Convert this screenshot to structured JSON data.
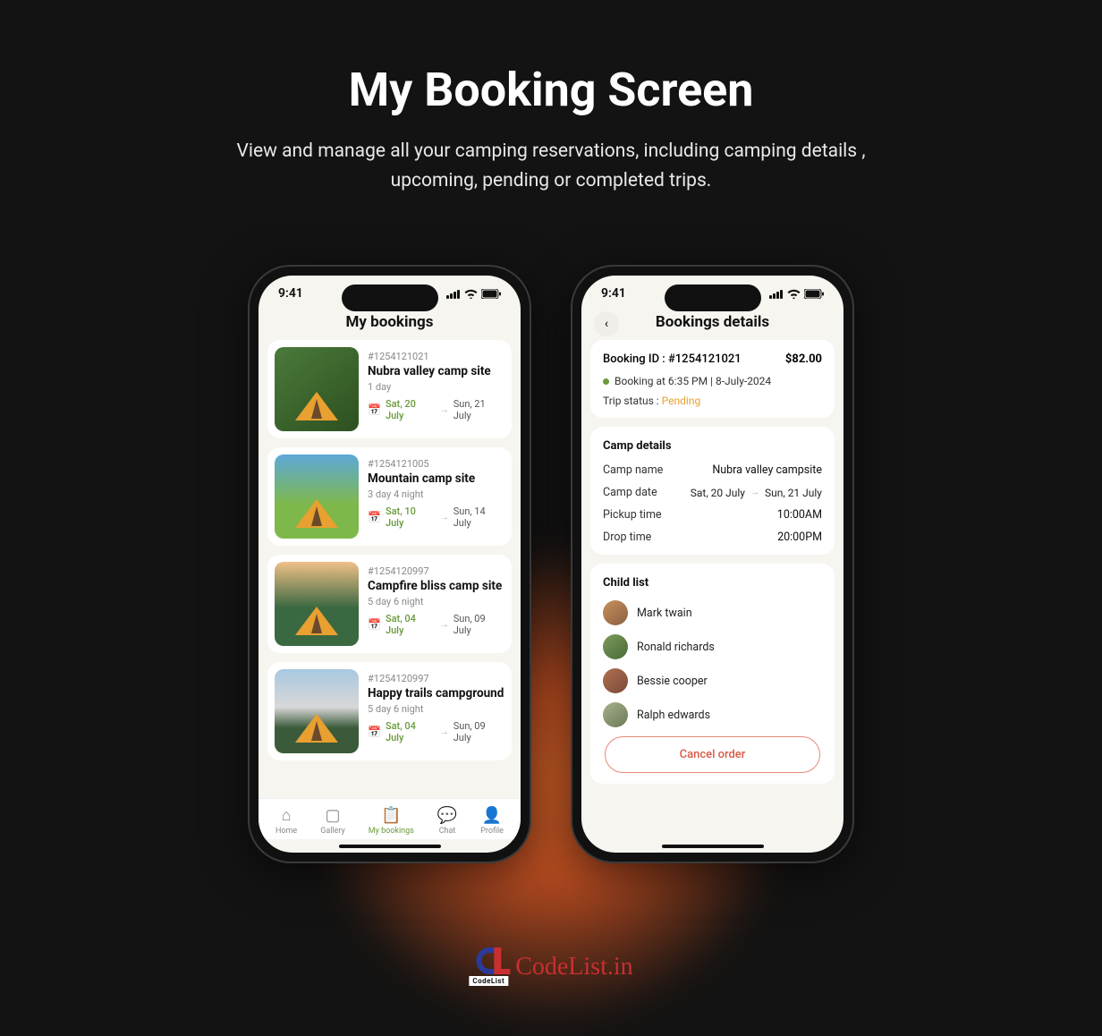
{
  "page": {
    "title": "My Booking Screen",
    "subtitle": "View and manage all your camping reservations, including camping details , upcoming, pending or completed trips."
  },
  "status": {
    "time": "9:41"
  },
  "phone1": {
    "header": "My bookings",
    "bookings": [
      {
        "id": "#1254121021",
        "title": "Nubra valley camp site",
        "duration": "1 day",
        "from": "Sat, 20 July",
        "to": "Sun, 21 July"
      },
      {
        "id": "#1254121005",
        "title": "Mountain camp site",
        "duration": "3 day 4 night",
        "from": "Sat, 10 July",
        "to": "Sun, 14 July"
      },
      {
        "id": "#1254120997",
        "title": "Campfire bliss camp site",
        "duration": "5 day 6 night",
        "from": "Sat, 04 July",
        "to": "Sun, 09 July"
      },
      {
        "id": "#1254120997",
        "title": "Happy trails campground",
        "duration": "5 day 6 night",
        "from": "Sat, 04 July",
        "to": "Sun, 09 July"
      }
    ],
    "nav": {
      "home": "Home",
      "gallery": "Gallery",
      "bookings": "My bookings",
      "chat": "Chat",
      "profile": "Profile"
    }
  },
  "phone2": {
    "header": "Bookings details",
    "booking_id_label": "Booking ID : #1254121021",
    "price": "$82.00",
    "meta": "Booking at 6:35 PM | 8-July-2024",
    "trip_status_label": "Trip status :",
    "trip_status_value": "Pending",
    "camp": {
      "title": "Camp details",
      "name_label": "Camp name",
      "name_value": "Nubra valley campsite",
      "date_label": "Camp date",
      "date_from": "Sat, 20 July",
      "date_to": "Sun, 21 July",
      "pickup_label": "Pickup time",
      "pickup_value": "10:00AM",
      "drop_label": "Drop time",
      "drop_value": "20:00PM"
    },
    "children": {
      "title": "Child list",
      "list": [
        "Mark twain",
        "Ronald richards",
        "Bessie cooper",
        "Ralph edwards"
      ]
    },
    "cancel": "Cancel order"
  },
  "brand": {
    "sub": "CodeList",
    "text": "CodeList.in"
  }
}
